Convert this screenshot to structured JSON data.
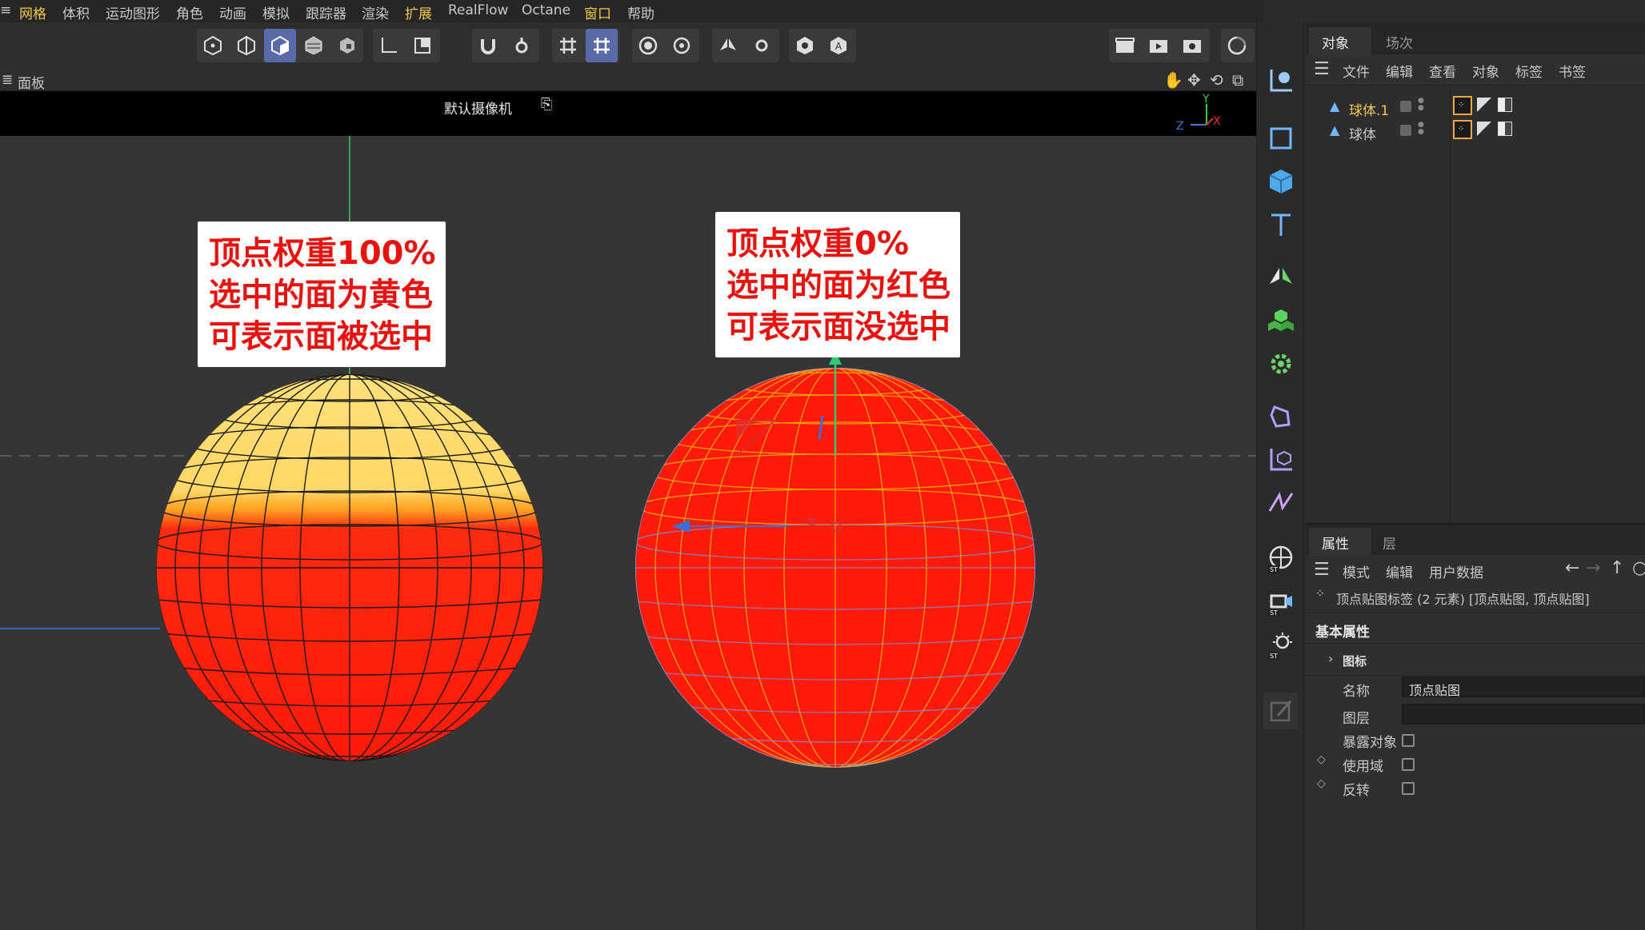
{
  "menubar": {
    "items": [
      "网格",
      "体积",
      "运动图形",
      "角色",
      "动画",
      "模拟",
      "跟踪器",
      "渲染",
      "扩展",
      "RealFlow",
      "Octane",
      "窗口",
      "帮助"
    ],
    "highlighted": [
      "网格",
      "扩展",
      "窗口"
    ]
  },
  "panelbar": {
    "label": "面板"
  },
  "viewport": {
    "camera_label": "默认摄像机",
    "axis_labels": {
      "y": "Y",
      "z": "Z",
      "x": "X"
    },
    "callout_left": {
      "line1": "顶点权重100%",
      "line2": "选中的面为黄色",
      "line3": "可表示面被选中"
    },
    "callout_right": {
      "line1": "顶点权重0%",
      "line2": "选中的面为红色",
      "line3": "可表示面没选中"
    }
  },
  "object_manager": {
    "tabs": [
      "对象",
      "场次"
    ],
    "menu": [
      "文件",
      "编辑",
      "查看",
      "对象",
      "标签",
      "书签"
    ],
    "objects": [
      {
        "name": "球体.1",
        "selected": true
      },
      {
        "name": "球体",
        "selected": false
      }
    ]
  },
  "attributes": {
    "tabs": [
      "属性",
      "层"
    ],
    "menu": [
      "模式",
      "编辑",
      "用户数据"
    ],
    "header": "顶点贴图标签 (2 元素) [顶点贴图, 顶点贴图]",
    "section": "基本属性",
    "group": "图标",
    "fields": {
      "name_label": "名称",
      "name_value": "顶点贴图",
      "layer_label": "图层",
      "expose_label": "暴露对象",
      "use_field_label": "使用域",
      "invert_label": "反转"
    }
  },
  "colors": {
    "accent_yellow": "#f2c84b",
    "selected_face": "#ffd966",
    "unselected_face": "#ff1a0a",
    "active_tool": "#5a6aa8"
  }
}
